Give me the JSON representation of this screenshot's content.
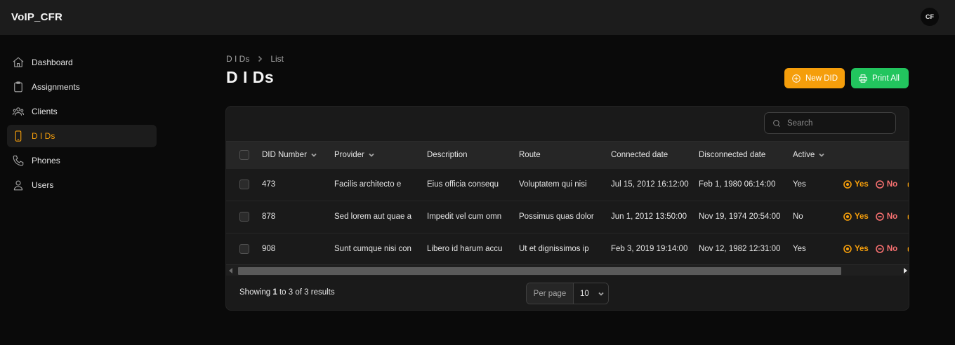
{
  "app": {
    "title": "VoIP_CFR",
    "avatar_initials": "CF"
  },
  "sidebar": {
    "items": [
      {
        "label": "Dashboard",
        "icon": "home-icon",
        "active": false
      },
      {
        "label": "Assignments",
        "icon": "clipboard-icon",
        "active": false
      },
      {
        "label": "Clients",
        "icon": "users-group-icon",
        "active": false
      },
      {
        "label": "D I Ds",
        "icon": "phone-device-icon",
        "active": true
      },
      {
        "label": "Phones",
        "icon": "phone-icon",
        "active": false
      },
      {
        "label": "Users",
        "icon": "user-icon",
        "active": false
      }
    ]
  },
  "breadcrumb": {
    "parent": "D I Ds",
    "current": "List"
  },
  "page": {
    "title": "D I Ds"
  },
  "actions": {
    "new_label": "New DID",
    "print_label": "Print All"
  },
  "search": {
    "placeholder": "Search"
  },
  "table": {
    "columns": [
      "DID Number",
      "Provider",
      "Description",
      "Route",
      "Connected date",
      "Disconnected date",
      "Active"
    ],
    "rows": [
      {
        "did": "473",
        "provider": "Facilis architecto e",
        "description": "Eius officia consequ",
        "route": "Voluptatem qui nisi",
        "connected": "Jul 15, 2012 16:12:00",
        "disconnected": "Feb 1, 1980 06:14:00",
        "active": "Yes"
      },
      {
        "did": "878",
        "provider": "Sed lorem aut quae a",
        "description": "Impedit vel cum omn",
        "route": "Possimus quas dolor",
        "connected": "Jun 1, 2012 13:50:00",
        "disconnected": "Nov 19, 1974 20:54:00",
        "active": "No"
      },
      {
        "did": "908",
        "provider": "Sunt cumque nisi con",
        "description": "Libero id harum accu",
        "route": "Ut et dignissimos ip",
        "connected": "Feb 3, 2019 19:14:00",
        "disconnected": "Nov 12, 1982 12:31:00",
        "active": "Yes"
      }
    ],
    "row_actions": {
      "yes_label": "Yes",
      "no_label": "No"
    }
  },
  "pagination": {
    "showing_prefix": "Showing",
    "from": "1",
    "to_word": "to",
    "to": "3",
    "of_word": "of",
    "total": "3",
    "results_word": "results",
    "per_page_label": "Per page",
    "per_page_value": "10"
  },
  "colors": {
    "accent": "#f59e0b",
    "success": "#22c55e",
    "danger": "#f87171"
  }
}
